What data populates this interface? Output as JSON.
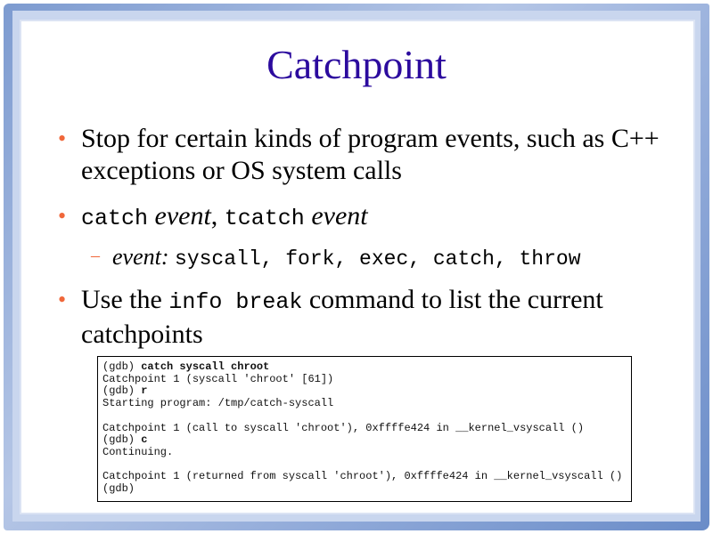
{
  "title": "Catchpoint",
  "accent_color": "#f0673a",
  "title_color": "#2c0b9e",
  "bullets": [
    {
      "text": "Stop for certain kinds of program events, such as C++ exceptions or OS system calls"
    },
    {
      "code1": "catch",
      "em1": "event",
      "sep": ",",
      "code2": "tcatch",
      "em2": "event"
    },
    {
      "text1": "Use the",
      "code": "info break",
      "text2": "command to list the current catchpoints"
    }
  ],
  "sub_bullet": {
    "em": "event:",
    "code": "syscall, fork, exec, catch, throw"
  },
  "code_lines": [
    {
      "prompt": "(gdb) ",
      "cmd": "catch syscall chroot"
    },
    {
      "out": "Catchpoint 1 (syscall 'chroot' [61])"
    },
    {
      "prompt": "(gdb) ",
      "cmd": "r"
    },
    {
      "out": "Starting program: /tmp/catch-syscall"
    },
    {
      "out": ""
    },
    {
      "out": "Catchpoint 1 (call to syscall 'chroot'), 0xffffe424 in __kernel_vsyscall ()"
    },
    {
      "prompt": "(gdb) ",
      "cmd": "c"
    },
    {
      "out": "Continuing."
    },
    {
      "out": ""
    },
    {
      "out": "Catchpoint 1 (returned from syscall 'chroot'), 0xffffe424 in __kernel_vsyscall ()"
    },
    {
      "out": "(gdb)"
    }
  ]
}
